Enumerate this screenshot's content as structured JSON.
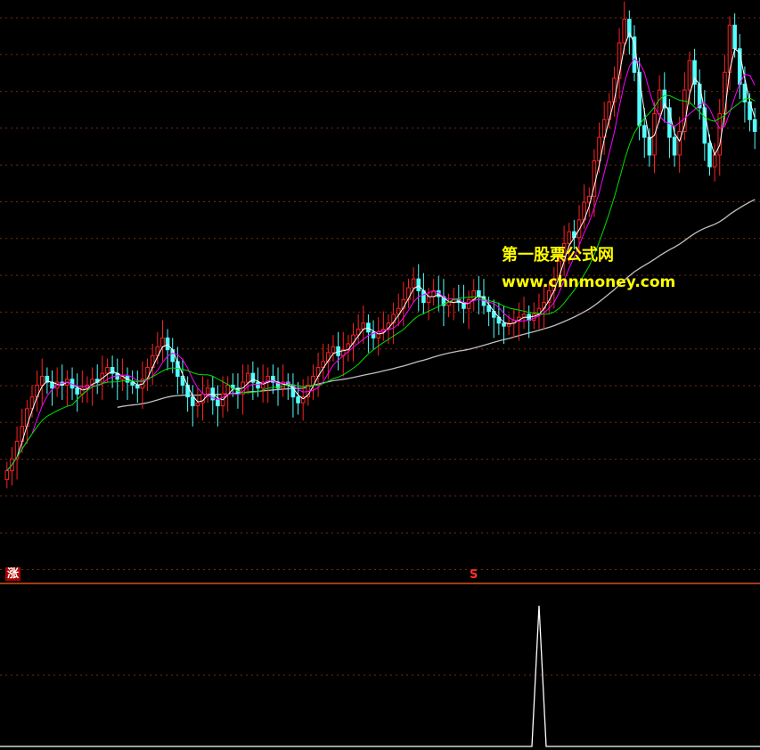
{
  "watermark": {
    "title": "第一股票公式网",
    "url": "www.chnmoney.com"
  },
  "signals": {
    "up_badge": "涨",
    "s_badge": "S"
  },
  "colors": {
    "background": "#000000",
    "grid": "#7a2a10",
    "up_candle": "#ff2222",
    "down_candle": "#54ffff",
    "ma_short": "#ffffff",
    "ma_mid": "#ff00ff",
    "ma_long": "#00e000",
    "ma_slow": "#c0c0c0",
    "divider": "#ff6020",
    "indicator": "#ffffff",
    "watermark": "#ffff00"
  },
  "chart_data": {
    "type": "candlestick",
    "main_panel": {
      "indicator_lines": [
        "ma_short",
        "ma_mid",
        "ma_long",
        "ma_slow"
      ],
      "close_series": [
        5,
        9,
        15,
        20,
        26,
        30,
        34,
        37,
        35,
        33,
        35,
        34,
        36,
        33,
        31,
        33,
        34,
        36,
        35,
        38,
        40,
        38,
        36,
        37,
        35,
        34,
        33,
        36,
        40,
        44,
        47,
        50,
        46,
        42,
        37,
        34,
        30,
        27,
        28,
        31,
        33,
        29,
        27,
        31,
        34,
        33,
        31,
        35,
        38,
        35,
        33,
        35,
        37,
        35,
        33,
        35,
        34,
        30,
        28,
        30,
        34,
        37,
        40,
        42,
        45,
        47,
        44,
        46,
        48,
        51,
        53,
        55,
        52,
        50,
        52,
        53,
        55,
        58,
        60,
        63,
        67,
        70,
        66,
        62,
        64,
        66,
        64,
        61,
        62,
        63,
        62,
        60,
        63,
        66,
        64,
        61,
        59,
        57,
        55,
        54,
        55,
        56,
        57,
        58,
        56,
        58,
        60,
        62,
        66,
        70,
        76,
        82,
        86,
        84,
        90,
        96,
        98,
        110,
        118,
        124,
        130,
        138,
        150,
        158,
        152,
        140,
        122,
        118,
        112,
        126,
        134,
        128,
        118,
        112,
        120,
        134,
        144,
        136,
        128,
        116,
        108,
        112,
        126,
        140,
        156,
        148,
        136,
        130,
        124,
        120
      ],
      "ma_slow_start_index": 22
    },
    "sub_panel": {
      "type": "line",
      "spike_index": 106,
      "spike_value": 1
    }
  }
}
